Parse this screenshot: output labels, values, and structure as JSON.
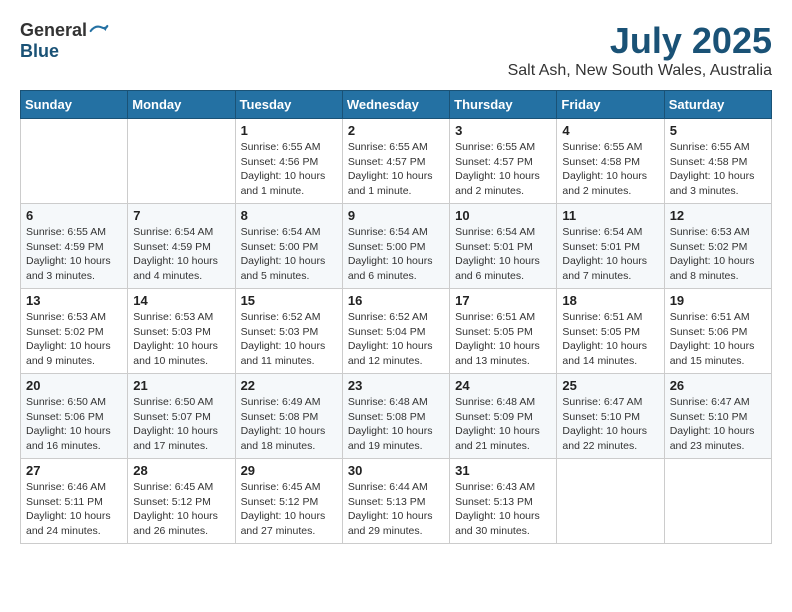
{
  "header": {
    "logo": {
      "general": "General",
      "blue": "Blue"
    },
    "title": "July 2025",
    "location": "Salt Ash, New South Wales, Australia"
  },
  "calendar": {
    "headers": [
      "Sunday",
      "Monday",
      "Tuesday",
      "Wednesday",
      "Thursday",
      "Friday",
      "Saturday"
    ],
    "weeks": [
      [
        {
          "day": "",
          "info": ""
        },
        {
          "day": "",
          "info": ""
        },
        {
          "day": "1",
          "info": "Sunrise: 6:55 AM\nSunset: 4:56 PM\nDaylight: 10 hours\nand 1 minute."
        },
        {
          "day": "2",
          "info": "Sunrise: 6:55 AM\nSunset: 4:57 PM\nDaylight: 10 hours\nand 1 minute."
        },
        {
          "day": "3",
          "info": "Sunrise: 6:55 AM\nSunset: 4:57 PM\nDaylight: 10 hours\nand 2 minutes."
        },
        {
          "day": "4",
          "info": "Sunrise: 6:55 AM\nSunset: 4:58 PM\nDaylight: 10 hours\nand 2 minutes."
        },
        {
          "day": "5",
          "info": "Sunrise: 6:55 AM\nSunset: 4:58 PM\nDaylight: 10 hours\nand 3 minutes."
        }
      ],
      [
        {
          "day": "6",
          "info": "Sunrise: 6:55 AM\nSunset: 4:59 PM\nDaylight: 10 hours\nand 3 minutes."
        },
        {
          "day": "7",
          "info": "Sunrise: 6:54 AM\nSunset: 4:59 PM\nDaylight: 10 hours\nand 4 minutes."
        },
        {
          "day": "8",
          "info": "Sunrise: 6:54 AM\nSunset: 5:00 PM\nDaylight: 10 hours\nand 5 minutes."
        },
        {
          "day": "9",
          "info": "Sunrise: 6:54 AM\nSunset: 5:00 PM\nDaylight: 10 hours\nand 6 minutes."
        },
        {
          "day": "10",
          "info": "Sunrise: 6:54 AM\nSunset: 5:01 PM\nDaylight: 10 hours\nand 6 minutes."
        },
        {
          "day": "11",
          "info": "Sunrise: 6:54 AM\nSunset: 5:01 PM\nDaylight: 10 hours\nand 7 minutes."
        },
        {
          "day": "12",
          "info": "Sunrise: 6:53 AM\nSunset: 5:02 PM\nDaylight: 10 hours\nand 8 minutes."
        }
      ],
      [
        {
          "day": "13",
          "info": "Sunrise: 6:53 AM\nSunset: 5:02 PM\nDaylight: 10 hours\nand 9 minutes."
        },
        {
          "day": "14",
          "info": "Sunrise: 6:53 AM\nSunset: 5:03 PM\nDaylight: 10 hours\nand 10 minutes."
        },
        {
          "day": "15",
          "info": "Sunrise: 6:52 AM\nSunset: 5:03 PM\nDaylight: 10 hours\nand 11 minutes."
        },
        {
          "day": "16",
          "info": "Sunrise: 6:52 AM\nSunset: 5:04 PM\nDaylight: 10 hours\nand 12 minutes."
        },
        {
          "day": "17",
          "info": "Sunrise: 6:51 AM\nSunset: 5:05 PM\nDaylight: 10 hours\nand 13 minutes."
        },
        {
          "day": "18",
          "info": "Sunrise: 6:51 AM\nSunset: 5:05 PM\nDaylight: 10 hours\nand 14 minutes."
        },
        {
          "day": "19",
          "info": "Sunrise: 6:51 AM\nSunset: 5:06 PM\nDaylight: 10 hours\nand 15 minutes."
        }
      ],
      [
        {
          "day": "20",
          "info": "Sunrise: 6:50 AM\nSunset: 5:06 PM\nDaylight: 10 hours\nand 16 minutes."
        },
        {
          "day": "21",
          "info": "Sunrise: 6:50 AM\nSunset: 5:07 PM\nDaylight: 10 hours\nand 17 minutes."
        },
        {
          "day": "22",
          "info": "Sunrise: 6:49 AM\nSunset: 5:08 PM\nDaylight: 10 hours\nand 18 minutes."
        },
        {
          "day": "23",
          "info": "Sunrise: 6:48 AM\nSunset: 5:08 PM\nDaylight: 10 hours\nand 19 minutes."
        },
        {
          "day": "24",
          "info": "Sunrise: 6:48 AM\nSunset: 5:09 PM\nDaylight: 10 hours\nand 21 minutes."
        },
        {
          "day": "25",
          "info": "Sunrise: 6:47 AM\nSunset: 5:10 PM\nDaylight: 10 hours\nand 22 minutes."
        },
        {
          "day": "26",
          "info": "Sunrise: 6:47 AM\nSunset: 5:10 PM\nDaylight: 10 hours\nand 23 minutes."
        }
      ],
      [
        {
          "day": "27",
          "info": "Sunrise: 6:46 AM\nSunset: 5:11 PM\nDaylight: 10 hours\nand 24 minutes."
        },
        {
          "day": "28",
          "info": "Sunrise: 6:45 AM\nSunset: 5:12 PM\nDaylight: 10 hours\nand 26 minutes."
        },
        {
          "day": "29",
          "info": "Sunrise: 6:45 AM\nSunset: 5:12 PM\nDaylight: 10 hours\nand 27 minutes."
        },
        {
          "day": "30",
          "info": "Sunrise: 6:44 AM\nSunset: 5:13 PM\nDaylight: 10 hours\nand 29 minutes."
        },
        {
          "day": "31",
          "info": "Sunrise: 6:43 AM\nSunset: 5:13 PM\nDaylight: 10 hours\nand 30 minutes."
        },
        {
          "day": "",
          "info": ""
        },
        {
          "day": "",
          "info": ""
        }
      ]
    ]
  }
}
